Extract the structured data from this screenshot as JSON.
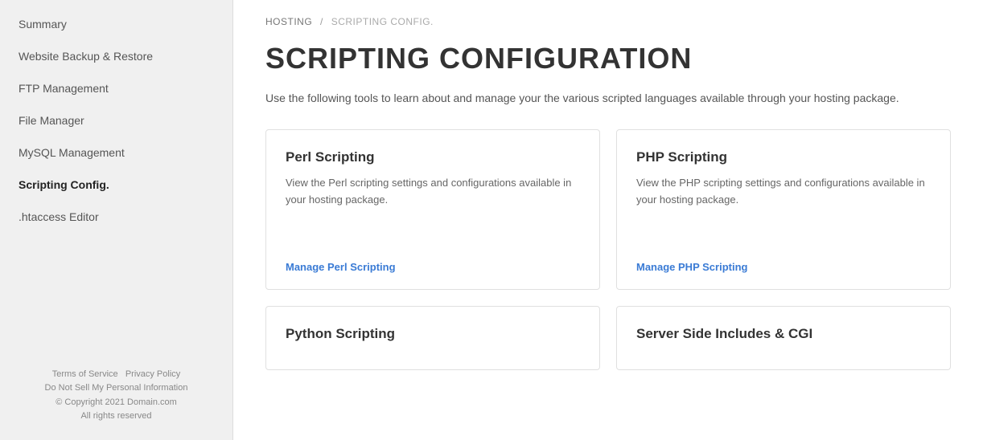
{
  "sidebar": {
    "items": [
      {
        "label": "Summary",
        "active": false,
        "id": "summary"
      },
      {
        "label": "Website Backup & Restore",
        "active": false,
        "id": "website-backup"
      },
      {
        "label": "FTP Management",
        "active": false,
        "id": "ftp-management"
      },
      {
        "label": "File Manager",
        "active": false,
        "id": "file-manager"
      },
      {
        "label": "MySQL Management",
        "active": false,
        "id": "mysql-management"
      },
      {
        "label": "Scripting Config.",
        "active": true,
        "id": "scripting-config"
      },
      {
        "label": ".htaccess Editor",
        "active": false,
        "id": "htaccess-editor"
      }
    ],
    "footer": {
      "links": [
        {
          "label": "Terms of Service"
        },
        {
          "label": "Privacy Policy"
        },
        {
          "label": "Do Not Sell My Personal Information"
        }
      ],
      "copyright": "© Copyright 2021 Domain.com",
      "rights": "All rights reserved"
    }
  },
  "breadcrumb": {
    "parent": "HOSTING",
    "separator": "/",
    "current": "SCRIPTING CONFIG."
  },
  "main": {
    "title": "SCRIPTING CONFIGURATION",
    "description": "Use the following tools to learn about and manage your the various scripted languages available through your hosting package.",
    "cards": [
      {
        "title": "Perl Scripting",
        "description": "View the Perl scripting settings and configurations available in your hosting package.",
        "link_label": "Manage Perl Scripting",
        "id": "perl"
      },
      {
        "title": "PHP Scripting",
        "description": "View the PHP scripting settings and configurations available in your hosting package.",
        "link_label": "Manage PHP Scripting",
        "id": "php"
      },
      {
        "title": "Python Scripting",
        "description": "",
        "link_label": "",
        "id": "python"
      },
      {
        "title": "Server Side Includes & CGI",
        "description": "",
        "link_label": "",
        "id": "ssi-cgi"
      }
    ]
  }
}
